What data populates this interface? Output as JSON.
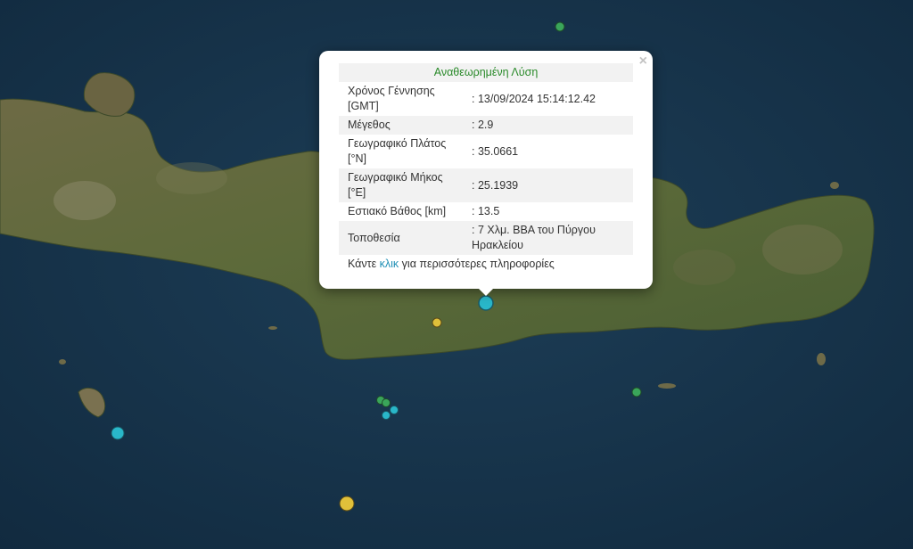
{
  "popup": {
    "title": "Αναθεωρημένη Λύση",
    "close_glyph": "×",
    "rows": [
      {
        "label": "Χρόνος Γέννησης [GMT]",
        "value": ": 13/09/2024 15:14:12.42"
      },
      {
        "label": "Μέγεθος",
        "value": ": 2.9"
      },
      {
        "label": "Γεωγραφικό Πλάτος [°N]",
        "value": ": 35.0661"
      },
      {
        "label": "Γεωγραφικό Μήκος [°E]",
        "value": ": 25.1939"
      },
      {
        "label": "Εστιακό Βάθος [km]",
        "value": ": 13.5"
      },
      {
        "label": "Τοποθεσία",
        "value": ": 7 Χλμ. ΒΒΑ του Πύργου Ηρακλείου"
      }
    ],
    "more_prefix": "Κάντε ",
    "more_link": "κλικ",
    "more_suffix": " για περισσότερες πληροφορίες"
  },
  "marker_colors": {
    "cyan": "#29b7c9",
    "green": "#3aa55a",
    "yellow": "#e0c03a"
  }
}
